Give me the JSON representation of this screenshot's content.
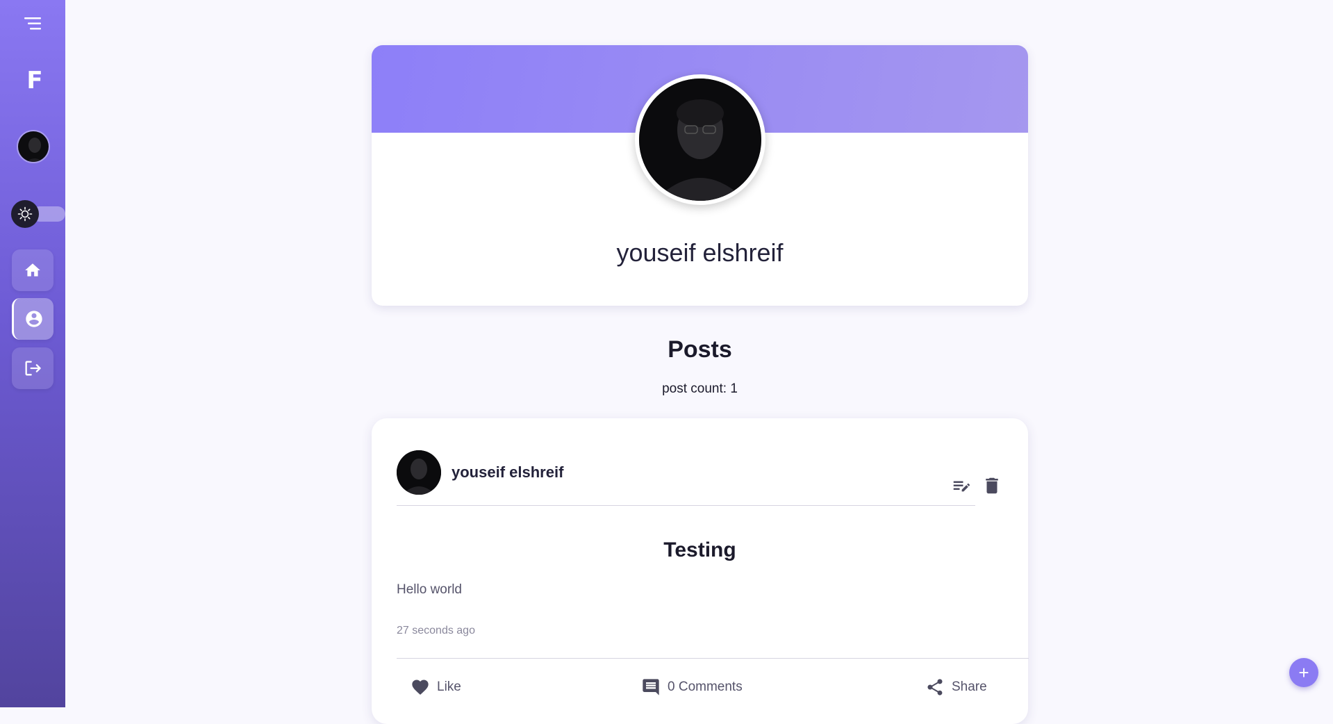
{
  "sidebar": {
    "brand": "F",
    "icons": {
      "menu": "menu-icon",
      "theme": "sun-icon",
      "home": "home-icon",
      "profile": "account-circle-icon",
      "logout": "logout-icon"
    }
  },
  "profile": {
    "name": "youseif elshreif"
  },
  "posts": {
    "heading": "Posts",
    "count_text": "post count: 1",
    "items": [
      {
        "author": "youseif elshreif",
        "title": "Testing",
        "body": "Hello world",
        "time": "27 seconds ago",
        "actions": {
          "like": "Like",
          "comments": "0 Comments",
          "share": "Share"
        }
      }
    ]
  },
  "fab": {
    "label": "+"
  },
  "colors": {
    "accent": "#8b7bf3",
    "sidebar_top": "#8a78f2",
    "sidebar_bottom": "#52449e",
    "background": "#f9f8fe"
  }
}
